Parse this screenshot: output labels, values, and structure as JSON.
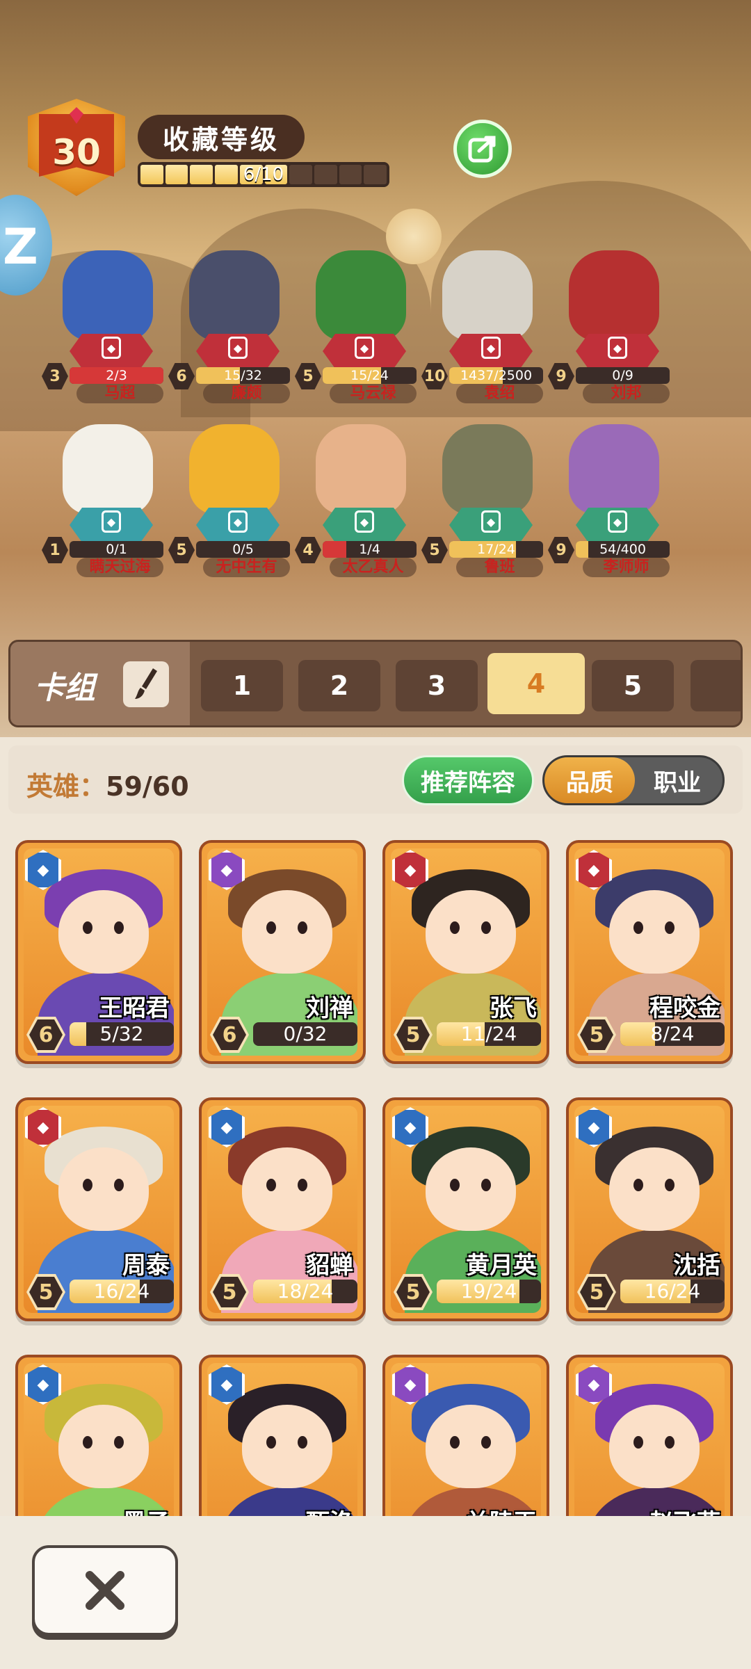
{
  "header": {
    "level": "30",
    "title": "收藏等级",
    "progress_text": "6/10",
    "progress_segments": 10,
    "progress_filled": 6
  },
  "showcase": [
    {
      "name": "马超",
      "star": "3",
      "progress": "2/3",
      "fill": 1.0,
      "color": "#d63838",
      "bg": "#3c63b8",
      "cls": "tank"
    },
    {
      "name": "廉颇",
      "star": "6",
      "progress": "15/32",
      "fill": 0.47,
      "color": "#f0c15a",
      "bg": "#4a4f6b",
      "cls": "tank"
    },
    {
      "name": "马云禄",
      "star": "5",
      "progress": "15/24",
      "fill": 0.62,
      "color": "#f0c15a",
      "bg": "#3b8a3a",
      "cls": "tank"
    },
    {
      "name": "袁绍",
      "star": "10",
      "progress": "1437/2500",
      "fill": 0.57,
      "color": "#f0c15a",
      "bg": "#d7d2c8",
      "cls": "tank"
    },
    {
      "name": "刘邦",
      "star": "9",
      "progress": "0/9",
      "fill": 0.0,
      "color": "#f0c15a",
      "bg": "#b63030",
      "cls": "king"
    },
    {
      "name": "瞒天过海",
      "star": "1",
      "progress": "0/1",
      "fill": 0.0,
      "color": "#f0c15a",
      "bg": "#f3f0e8",
      "cls": "spell"
    },
    {
      "name": "无中生有",
      "star": "5",
      "progress": "0/5",
      "fill": 0.0,
      "color": "#f0c15a",
      "bg": "#f1b22e",
      "cls": "spell"
    },
    {
      "name": "太乙真人",
      "star": "4",
      "progress": "1/4",
      "fill": 0.25,
      "color": "#d63838",
      "bg": "#e7b28a",
      "cls": "item"
    },
    {
      "name": "鲁班",
      "star": "5",
      "progress": "17/24",
      "fill": 0.71,
      "color": "#f0c15a",
      "bg": "#7a7a5a",
      "cls": "item"
    },
    {
      "name": "李师师",
      "star": "9",
      "progress": "54/400",
      "fill": 0.13,
      "color": "#f0c15a",
      "bg": "#9a6ab8",
      "cls": "item"
    }
  ],
  "deck": {
    "label": "卡组",
    "tabs": [
      "1",
      "2",
      "3",
      "4",
      "5"
    ],
    "active_index": 3
  },
  "filter": {
    "hero_label": "英雄：",
    "hero_count": "59/60",
    "recommend": "推荐阵容",
    "toggle_on": "品质",
    "toggle_off": "职业"
  },
  "cards": [
    {
      "name": "王昭君",
      "star": "6",
      "progress": "5/32",
      "fill": 0.16,
      "cls": "mage",
      "hair": "#7b3fb0",
      "body": "#6a4ab2"
    },
    {
      "name": "刘禅",
      "star": "6",
      "progress": "0/32",
      "fill": 0.0,
      "cls": "assassin",
      "hair": "#7a4a2a",
      "body": "#8bcf74"
    },
    {
      "name": "张飞",
      "star": "5",
      "progress": "11/24",
      "fill": 0.46,
      "cls": "warrior",
      "hair": "#2e2520",
      "body": "#c9b85a"
    },
    {
      "name": "程咬金",
      "star": "5",
      "progress": "8/24",
      "fill": 0.33,
      "cls": "warrior",
      "hair": "#3c3c6a",
      "body": "#d9a890"
    },
    {
      "name": "周泰",
      "star": "5",
      "progress": "16/24",
      "fill": 0.67,
      "cls": "warrior",
      "hair": "#e8e0d0",
      "body": "#4a7ed0"
    },
    {
      "name": "貂蝉",
      "star": "5",
      "progress": "18/24",
      "fill": 0.75,
      "cls": "mage",
      "hair": "#8a3a2a",
      "body": "#f0a8b8"
    },
    {
      "name": "黄月英",
      "star": "5",
      "progress": "19/24",
      "fill": 0.79,
      "cls": "mage",
      "hair": "#2a3a2a",
      "body": "#5ab05a"
    },
    {
      "name": "沈括",
      "star": "5",
      "progress": "16/24",
      "fill": 0.67,
      "cls": "mage",
      "hair": "#3a3030",
      "body": "#6a4a3a"
    },
    {
      "name": "墨子",
      "star": "",
      "progress": "",
      "fill": 0.0,
      "cls": "mage",
      "hair": "#c8b83a",
      "body": "#8ad060"
    },
    {
      "name": "甄洛",
      "star": "",
      "progress": "",
      "fill": 0.0,
      "cls": "mage",
      "hair": "#2a2028",
      "body": "#3a3a8a"
    },
    {
      "name": "兰陵王",
      "star": "",
      "progress": "",
      "fill": 0.0,
      "cls": "assassin",
      "hair": "#3a5ab0",
      "body": "#b05a3a"
    },
    {
      "name": "赵飞燕",
      "star": "",
      "progress": "",
      "fill": 0.0,
      "cls": "assassin",
      "hair": "#7a3ab0",
      "body": "#4a2a5a"
    }
  ],
  "class_colors": {
    "mage": "#2f6fc0",
    "assassin": "#8a4ac0",
    "warrior": "#c0303a",
    "tank": "#c0303a",
    "king": "#c0303a",
    "spell": "#3aa0a8",
    "item": "#3aa07a"
  },
  "close_icon": "close-x-icon"
}
